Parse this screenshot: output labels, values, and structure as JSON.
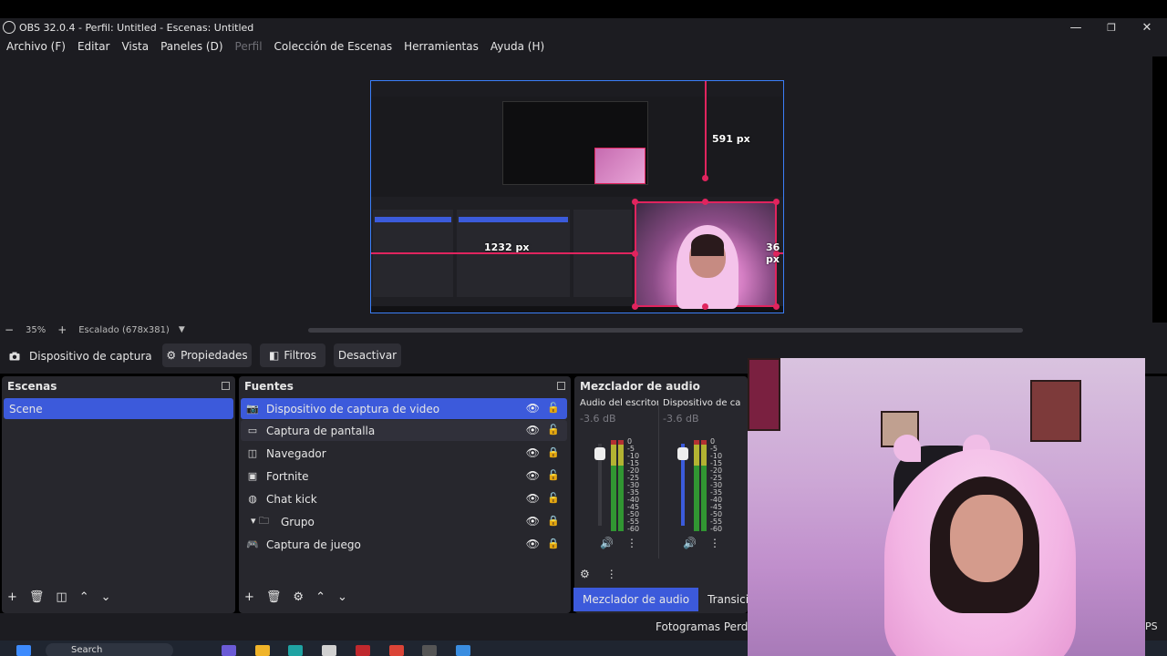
{
  "window": {
    "title": "OBS 32.0.4 - Perfil: Untitled - Escenas: Untitled",
    "minimize_glyph": "—",
    "maximize_glyph": "❐",
    "close_glyph": "✕"
  },
  "menu": {
    "items": [
      "Archivo (F)",
      "Editar",
      "Vista",
      "Paneles (D)",
      "Perfil",
      "Colección de Escenas",
      "Herramientas",
      "Ayuda (H)"
    ]
  },
  "preview": {
    "measure_top": "591 px",
    "measure_left": "1232 px",
    "measure_right": "36 px",
    "accent_color": "#3b7ef8",
    "guide_color": "#e0245e"
  },
  "zoombar": {
    "minus": "−",
    "zoom": "35%",
    "plus": "+",
    "scale": "Escalado (678x381)",
    "caret": "▼"
  },
  "context": {
    "source_label": "Dispositivo de captura de v",
    "properties": "Propiedades",
    "filters": "Filtros",
    "deactivate": "Desactivar"
  },
  "scenes": {
    "title": "Escenas",
    "items": [
      "Scene"
    ]
  },
  "sources": {
    "title": "Fuentes",
    "items": [
      {
        "label": "Dispositivo de captura de video",
        "icon": "camera-icon",
        "glyph": "📷",
        "locked": false
      },
      {
        "label": "Captura de pantalla",
        "icon": "monitor-icon",
        "glyph": "▭",
        "locked": false
      },
      {
        "label": "Navegador",
        "icon": "browser-icon",
        "glyph": "◫",
        "locked": true
      },
      {
        "label": "Fortnite",
        "icon": "window-icon",
        "glyph": "▣",
        "locked": false
      },
      {
        "label": "Chat kick",
        "icon": "globe-icon",
        "glyph": "◍",
        "locked": false
      },
      {
        "label": "Grupo",
        "icon": "folder-icon",
        "glyph": "▾ 🗀",
        "locked": true
      },
      {
        "label": "Captura de juego",
        "icon": "gamepad-icon",
        "glyph": "🎮",
        "locked": true
      }
    ]
  },
  "mixer": {
    "title": "Mezclador de audio",
    "channels": [
      {
        "name": "Audio del escritorio",
        "db": "-3.6 dB"
      },
      {
        "name": "Dispositivo de captura",
        "db": "-3.6 dB"
      }
    ],
    "scale": [
      "0",
      "-5",
      "-10",
      "-15",
      "-20",
      "-25",
      "-30",
      "-35",
      "-40",
      "-45",
      "-50",
      "-55",
      "-60"
    ],
    "tabs": [
      "Mezclador de audio",
      "Transiciones"
    ]
  },
  "status": {
    "dropped": "Fotogramas Perdidos",
    "fps": "PS"
  },
  "taskbar": {
    "search": "Search"
  }
}
